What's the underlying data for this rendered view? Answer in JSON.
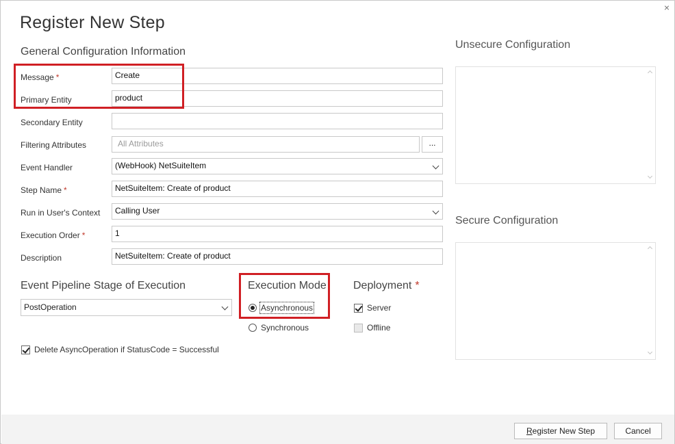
{
  "dialog": {
    "title": "Register New Step",
    "close_glyph": "×"
  },
  "general": {
    "heading": "General Configuration Information",
    "required_mark": "*",
    "message": {
      "label": "Message",
      "value": "Create"
    },
    "primary_entity": {
      "label": "Primary Entity",
      "value": "product"
    },
    "secondary_entity": {
      "label": "Secondary Entity",
      "value": ""
    },
    "filtering_attributes": {
      "label": "Filtering Attributes",
      "placeholder": "All Attributes",
      "button": "..."
    },
    "event_handler": {
      "label": "Event Handler",
      "value": "(WebHook) NetSuiteItem"
    },
    "step_name": {
      "label": "Step Name",
      "value": "NetSuiteItem: Create of product"
    },
    "run_context": {
      "label": "Run in User's Context",
      "value": "Calling User"
    },
    "execution_order": {
      "label": "Execution Order",
      "value": "1"
    },
    "description": {
      "label": "Description",
      "value": "NetSuiteItem: Create of product"
    }
  },
  "pipeline": {
    "heading": "Event Pipeline Stage of Execution",
    "value": "PostOperation",
    "delete_async": {
      "label": "Delete AsyncOperation if StatusCode = Successful",
      "checked": true
    }
  },
  "execution_mode": {
    "heading": "Execution Mode",
    "options": [
      {
        "label": "Asynchronous",
        "selected": true
      },
      {
        "label": "Synchronous",
        "selected": false
      }
    ]
  },
  "deployment": {
    "heading": "Deployment",
    "required_mark": "*",
    "server": {
      "label": "Server",
      "checked": true
    },
    "offline": {
      "label": "Offline",
      "checked": false
    }
  },
  "unsecure_config": {
    "heading": "Unsecure  Configuration",
    "value": ""
  },
  "secure_config": {
    "heading": "Secure  Configuration",
    "value": ""
  },
  "footer": {
    "register_prefix": "R",
    "register_rest": "egister New Step",
    "cancel": "Cancel"
  },
  "colors": {
    "highlight": "#d01f24",
    "required": "#c0392b",
    "footer_bg": "#f3f3f3"
  }
}
